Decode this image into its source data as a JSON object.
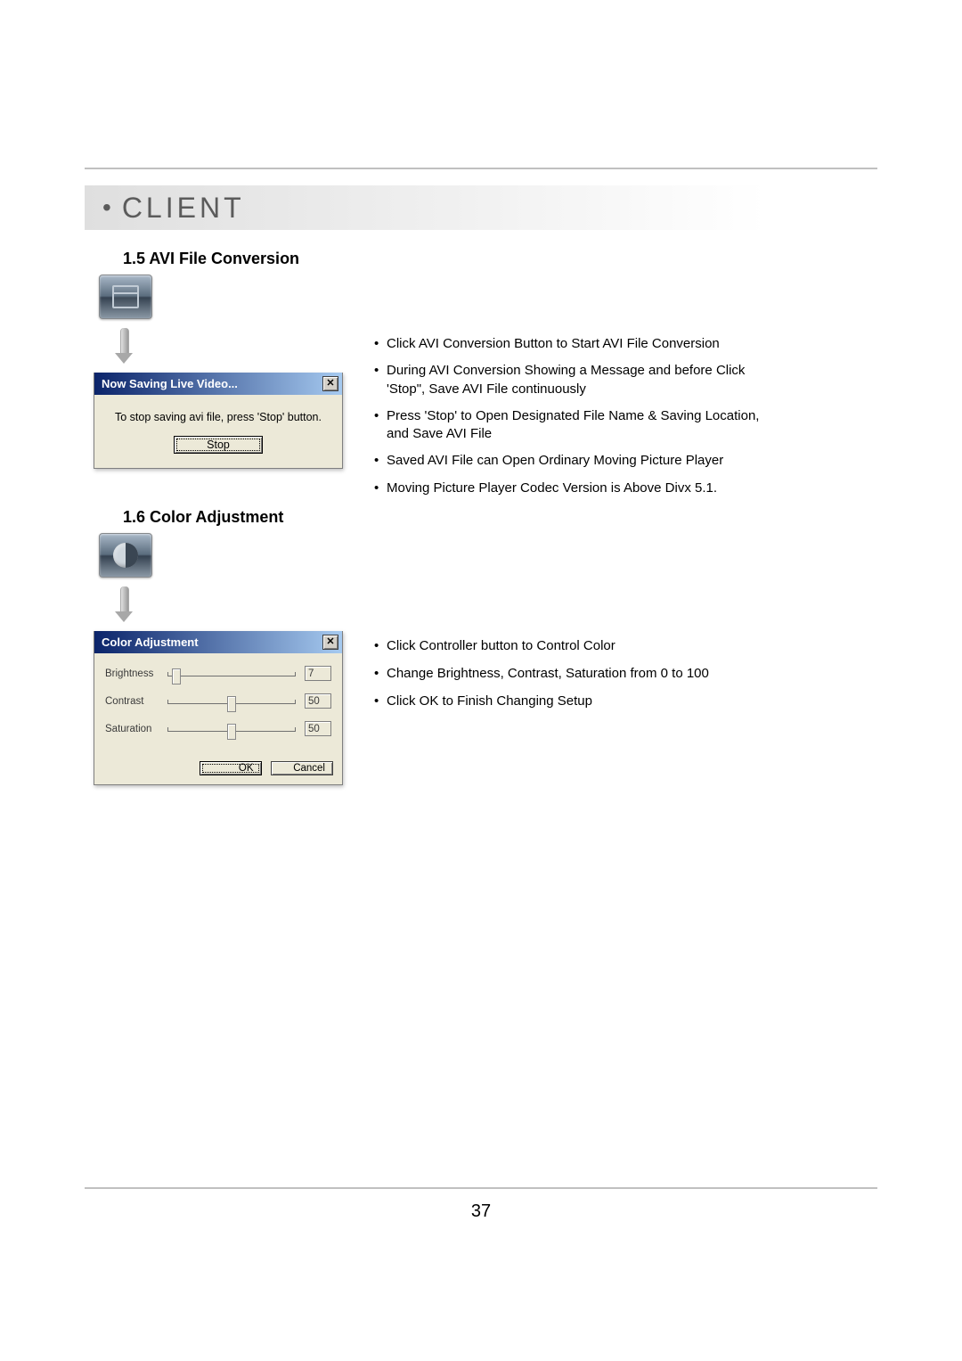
{
  "page": {
    "title": "CLIENT",
    "page_number": "37"
  },
  "section1": {
    "heading": "1.5 AVI File Conversion",
    "dialog": {
      "title": "Now Saving Live Video...",
      "close_glyph": "✕",
      "message": "To stop saving avi file, press 'Stop' button.",
      "button_label": "Stop"
    },
    "bullets": [
      "Click AVI Conversion Button to Start AVI File Conversion",
      "During AVI Conversion Showing a Message and before Click 'Stop\", Save AVI File continuously",
      "Press 'Stop' to Open Designated File Name & Saving Location, and Save AVI File",
      "Saved AVI File can Open Ordinary Moving Picture Player",
      "Moving Picture Player Codec Version is Above Divx 5.1."
    ]
  },
  "section2": {
    "heading": "1.6 Color Adjustment",
    "dialog": {
      "title": "Color Adjustment",
      "close_glyph": "✕",
      "rows": [
        {
          "label": "Brightness",
          "value": "7",
          "position_pct": 7
        },
        {
          "label": "Contrast",
          "value": "50",
          "position_pct": 50
        },
        {
          "label": "Saturation",
          "value": "50",
          "position_pct": 50
        }
      ],
      "ok_label": "OK",
      "cancel_label": "Cancel"
    },
    "bullets": [
      "Click Controller button to Control Color",
      "Change Brightness, Contrast, Saturation  from 0  to 100",
      "Click OK to Finish Changing Setup"
    ]
  }
}
